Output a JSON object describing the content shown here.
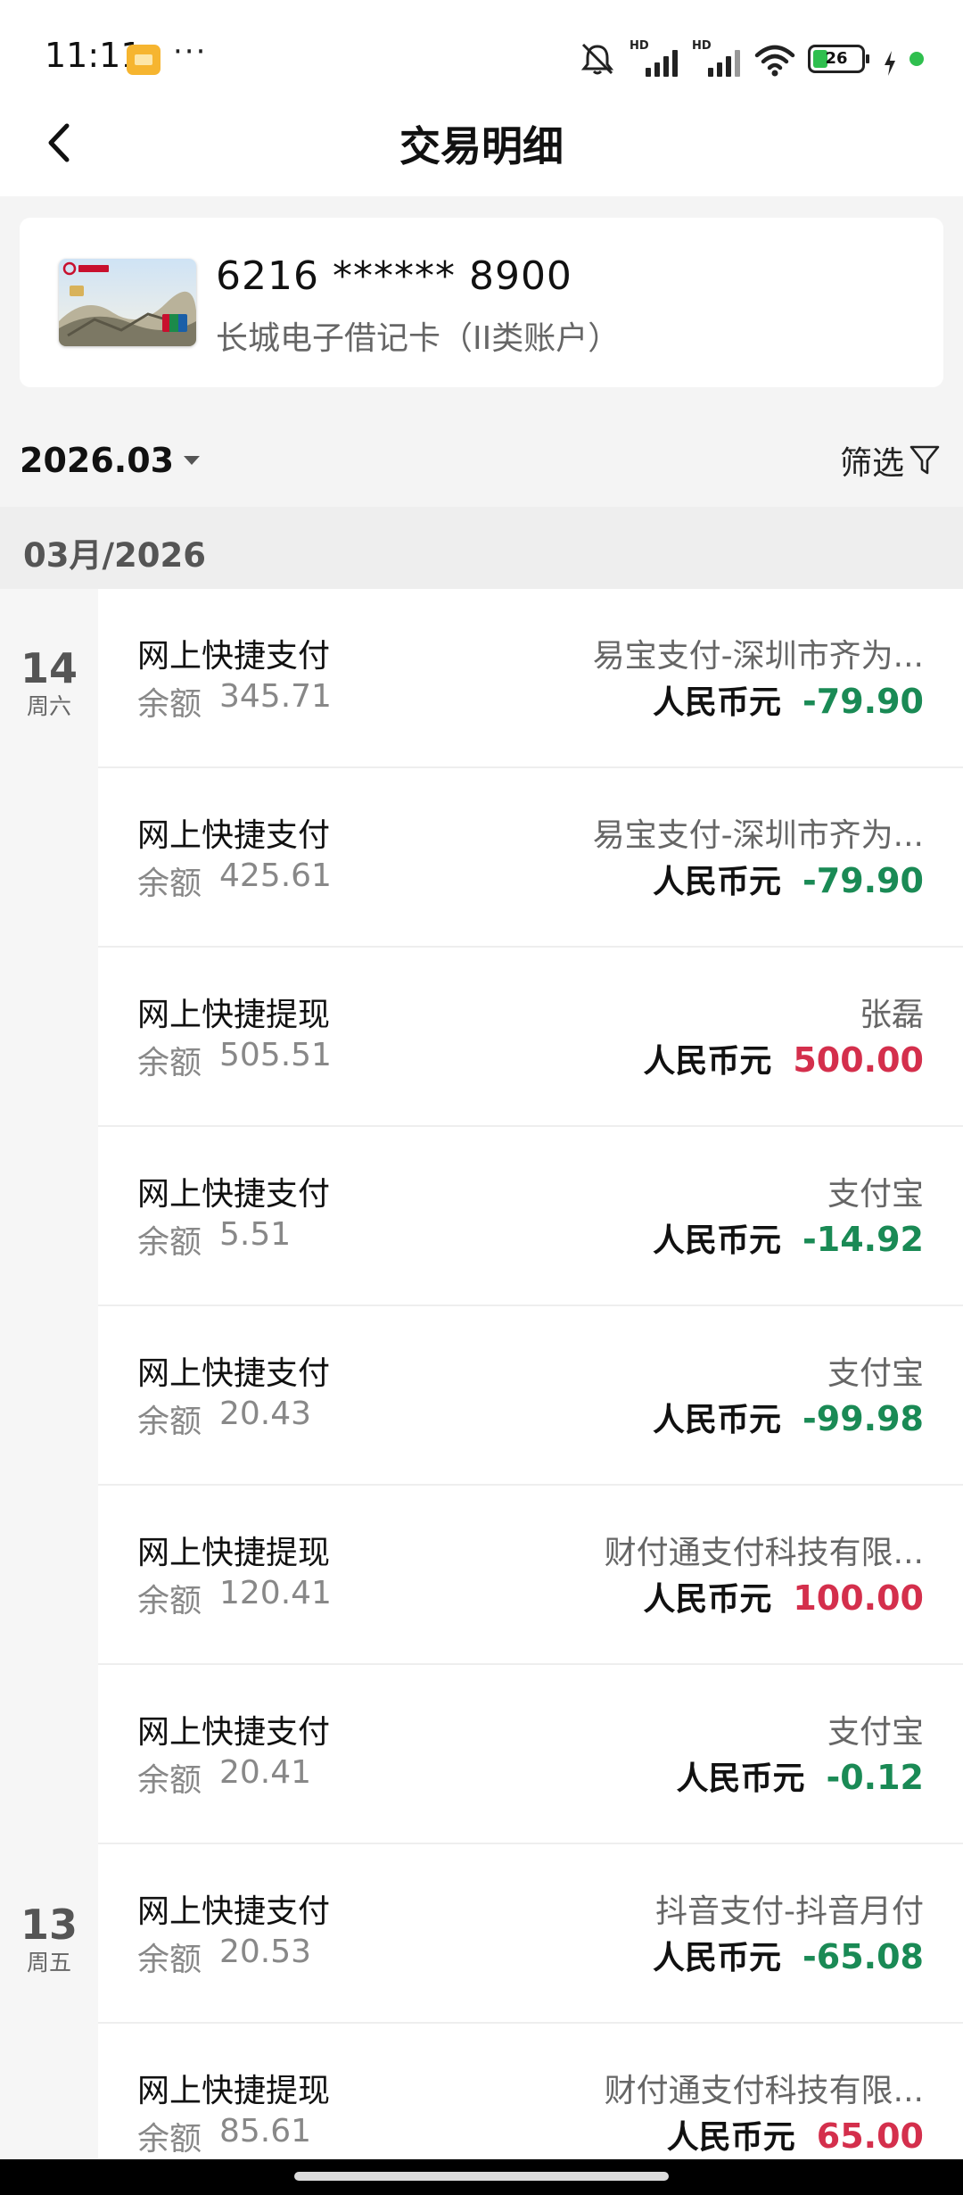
{
  "status_bar": {
    "time": "11:11",
    "dots": "···",
    "battery": "26",
    "icons": [
      "notes-app-icon",
      "mute-icon",
      "hd-signal-icon",
      "hd-signal-icon",
      "wifi-icon",
      "battery-icon",
      "charging-icon"
    ]
  },
  "header": {
    "title": "交易明细"
  },
  "card": {
    "number": "6216 ****** 8900",
    "type": "长城电子借记卡（II类账户）"
  },
  "filter": {
    "month": "2026.03",
    "filter_label": "筛选"
  },
  "month_header": "03月/2026",
  "colors": {
    "debit": "#1a8a55",
    "credit": "#d42f4c"
  },
  "dates": [
    {
      "day": "14",
      "week": "周六"
    },
    {
      "day": "13",
      "week": "周五"
    }
  ],
  "transactions": [
    {
      "type": "网上快捷支付",
      "balance_label": "余额",
      "balance": "345.71",
      "party": "易宝支付-深圳市齐为...",
      "currency": "人民币元",
      "amount": "-79.90"
    },
    {
      "type": "网上快捷支付",
      "balance_label": "余额",
      "balance": "425.61",
      "party": "易宝支付-深圳市齐为...",
      "currency": "人民币元",
      "amount": "-79.90"
    },
    {
      "type": "网上快捷提现",
      "balance_label": "余额",
      "balance": "505.51",
      "party": "张磊",
      "currency": "人民币元",
      "amount": "500.00"
    },
    {
      "type": "网上快捷支付",
      "balance_label": "余额",
      "balance": "5.51",
      "party": "支付宝",
      "currency": "人民币元",
      "amount": "-14.92"
    },
    {
      "type": "网上快捷支付",
      "balance_label": "余额",
      "balance": "20.43",
      "party": "支付宝",
      "currency": "人民币元",
      "amount": "-99.98"
    },
    {
      "type": "网上快捷提现",
      "balance_label": "余额",
      "balance": "120.41",
      "party": "财付通支付科技有限...",
      "currency": "人民币元",
      "amount": "100.00"
    },
    {
      "type": "网上快捷支付",
      "balance_label": "余额",
      "balance": "20.41",
      "party": "支付宝",
      "currency": "人民币元",
      "amount": "-0.12"
    },
    {
      "type": "网上快捷支付",
      "balance_label": "余额",
      "balance": "20.53",
      "party": "抖音支付-抖音月付",
      "currency": "人民币元",
      "amount": "-65.08"
    },
    {
      "type": "网上快捷提现",
      "balance_label": "余额",
      "balance": "85.61",
      "party": "财付通支付科技有限...",
      "currency": "人民币元",
      "amount": "65.00"
    }
  ]
}
